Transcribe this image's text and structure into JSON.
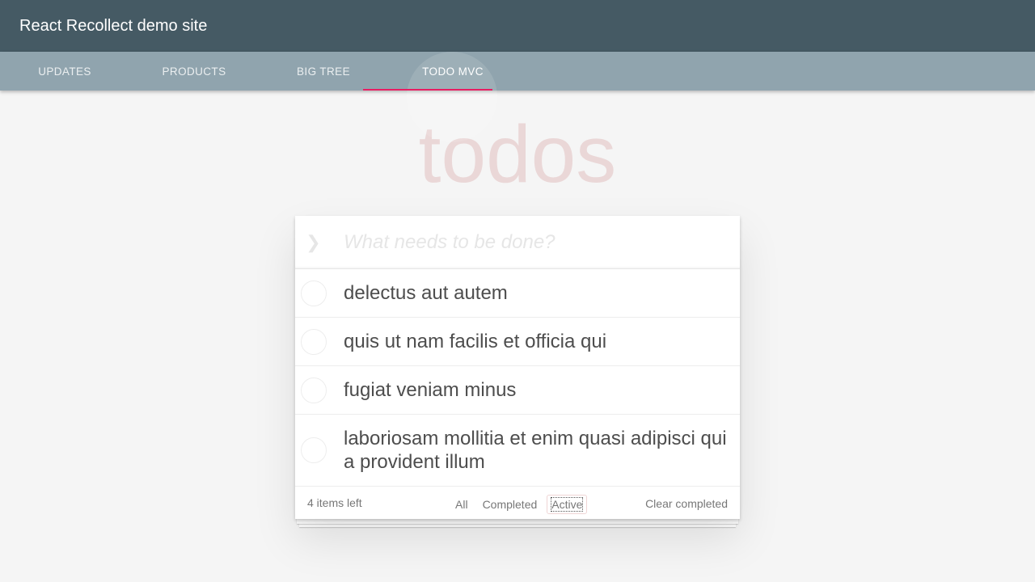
{
  "appbar": {
    "title": "React Recollect demo site"
  },
  "tabs": [
    {
      "label": "UPDATES",
      "active": false
    },
    {
      "label": "PRODUCTS",
      "active": false
    },
    {
      "label": "BIG TREE",
      "active": false
    },
    {
      "label": "TODO MVC",
      "active": true
    }
  ],
  "todo": {
    "heading": "todos",
    "new_todo_placeholder": "What needs to be done?",
    "toggle_all_icon": "chevron-down-icon",
    "items": [
      {
        "text": "delectus aut autem",
        "completed": false
      },
      {
        "text": "quis ut nam facilis et officia qui",
        "completed": false
      },
      {
        "text": "fugiat veniam minus",
        "completed": false
      },
      {
        "text": "laboriosam mollitia et enim quasi adipisci qui a provident illum",
        "completed": false
      }
    ],
    "footer": {
      "count": "4 items left",
      "filters": [
        "All",
        "Completed",
        "Active"
      ],
      "selected_filter": "Active",
      "clear_label": "Clear completed"
    }
  },
  "colors": {
    "appbar": "#455a64",
    "tabbar": "#90a4ae",
    "tab_indicator": "#e91e63",
    "heading": "rgba(175, 47, 47, 0.15)"
  }
}
